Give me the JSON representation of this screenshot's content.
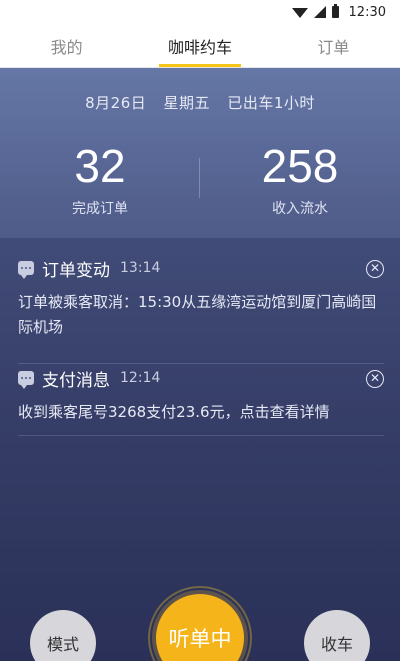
{
  "status_bar": {
    "time": "12:30",
    "icons": [
      "wifi-icon",
      "signal-icon",
      "battery-icon"
    ]
  },
  "tabs": [
    {
      "label": "我的",
      "active": false
    },
    {
      "label": "咖啡约车",
      "active": true
    },
    {
      "label": "订单",
      "active": false
    }
  ],
  "summary": {
    "date": "8月26日",
    "weekday": "星期五",
    "duration": "已出车1小时"
  },
  "stats": {
    "orders_value": "32",
    "orders_label": "完成订单",
    "income_value": "258",
    "income_label": "收入流水"
  },
  "messages": [
    {
      "icon": "chat-icon",
      "title": "订单变动",
      "time": "13:14",
      "body": "订单被乘客取消：15:30从五缘湾运动馆到厦门高崎国际机场"
    },
    {
      "icon": "chat-icon",
      "title": "支付消息",
      "time": "12:14",
      "body": "收到乘客尾号3268支付23.6元，点击查看详情"
    }
  ],
  "controls": {
    "mode_label": "模式",
    "listen_label": "听单中",
    "off_label": "收车"
  },
  "colors": {
    "accent": "#f5b41a",
    "panel_top": "#6577a6",
    "panel_bottom": "#2c3157"
  }
}
